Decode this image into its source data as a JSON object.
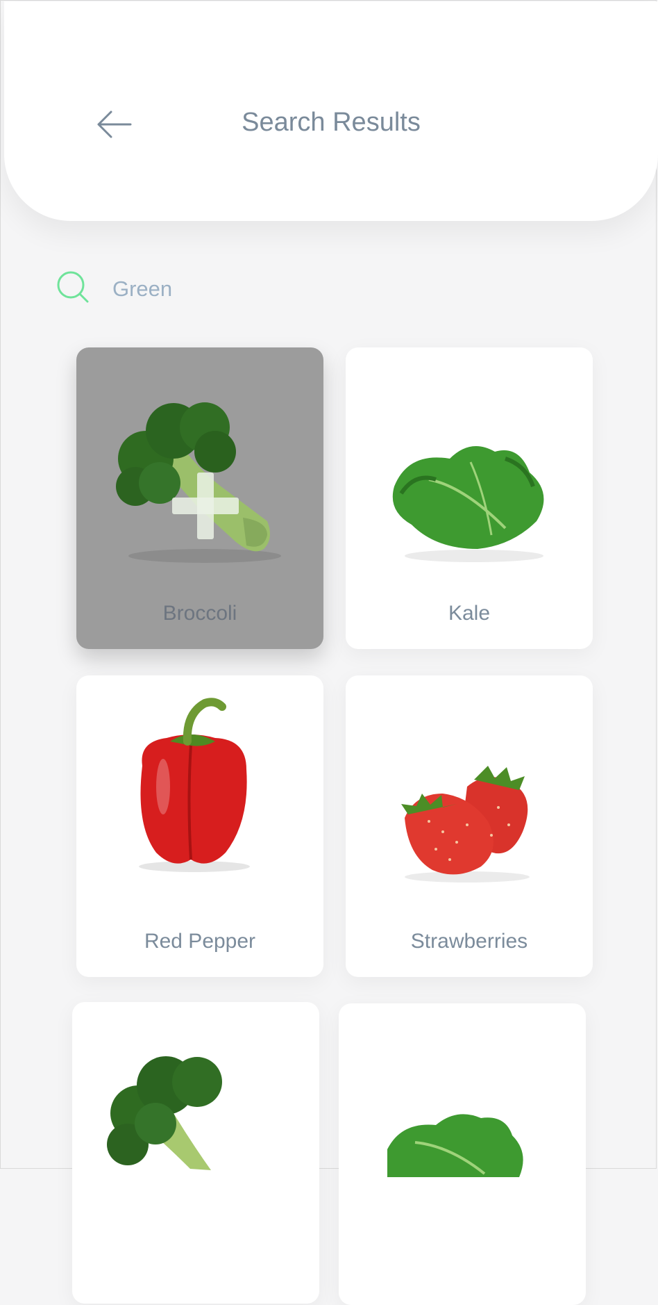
{
  "header": {
    "title": "Search Results",
    "back_icon": "arrow-left-icon"
  },
  "search": {
    "value": "Green",
    "icon": "search-icon",
    "accent_color": "#6fe39a"
  },
  "results": [
    {
      "label": "Broccoli",
      "selected": true,
      "action_icon": "plus-icon"
    },
    {
      "label": "Kale",
      "selected": false
    },
    {
      "label": "Red Pepper",
      "selected": false
    },
    {
      "label": "Strawberries",
      "selected": false
    },
    {
      "label": "",
      "selected": false
    },
    {
      "label": "",
      "selected": false
    }
  ]
}
